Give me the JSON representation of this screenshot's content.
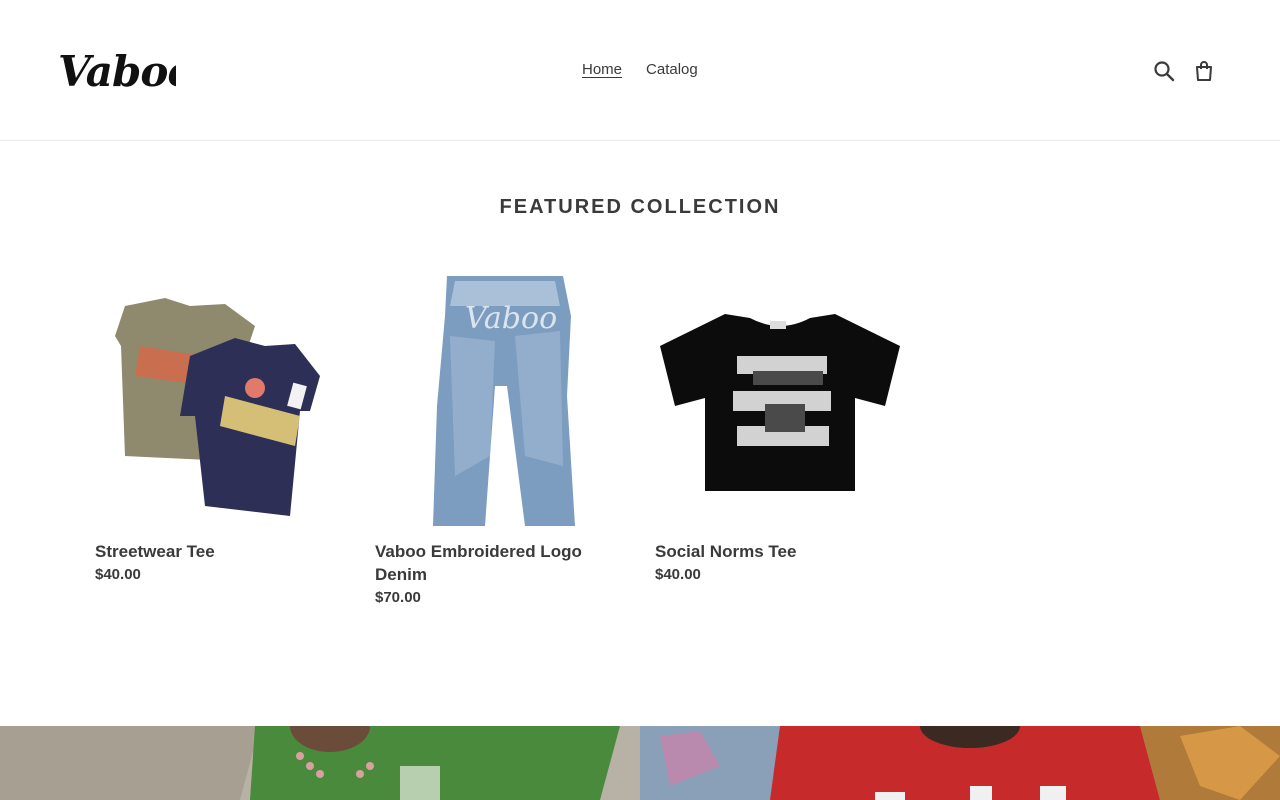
{
  "header": {
    "logo_text": "Vaboo",
    "nav": [
      {
        "label": "Home",
        "active": true
      },
      {
        "label": "Catalog",
        "active": false
      }
    ],
    "icons": [
      "search-icon",
      "cart-icon"
    ]
  },
  "section": {
    "title": "FEATURED COLLECTION"
  },
  "products": [
    {
      "title": "Streetwear Tee",
      "price": "$40.00",
      "image_icon": "tshirt-pair-image"
    },
    {
      "title": "Vaboo Embroidered Logo Denim",
      "price": "$70.00",
      "image_icon": "jeans-image"
    },
    {
      "title": "Social Norms Tee",
      "price": "$40.00",
      "image_icon": "black-tshirt-image"
    }
  ],
  "colors": {
    "text": "#3a3a3a",
    "border": "#e8e9eb",
    "background": "#ffffff"
  }
}
